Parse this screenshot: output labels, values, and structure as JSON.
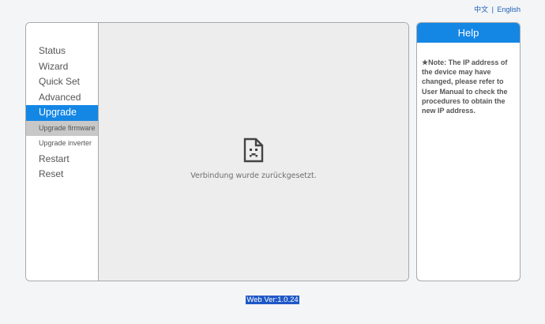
{
  "language": {
    "chinese": "中文",
    "separator": "|",
    "english": "English"
  },
  "nav": {
    "status": "Status",
    "wizard": "Wizard",
    "quick_set": "Quick Set",
    "advanced": "Advanced",
    "upgrade": "Upgrade",
    "upgrade_firmware": "Upgrade firmware",
    "upgrade_inverter": "Upgrade inverter",
    "restart": "Restart",
    "reset": "Reset"
  },
  "content": {
    "error_icon": "sad-document-icon",
    "error_message": "Verbindung wurde zurückgesetzt."
  },
  "help": {
    "title": "Help",
    "note": "★Note: The IP address of the device may have changed, please refer to User Manual to check the procedures to obtain the new IP address."
  },
  "footer": {
    "version": "Web Ver:1.0.24"
  },
  "colors": {
    "accent": "#1487e5",
    "selected_sub": "#c8c8c8",
    "footer_highlight": "#1e58c6"
  }
}
